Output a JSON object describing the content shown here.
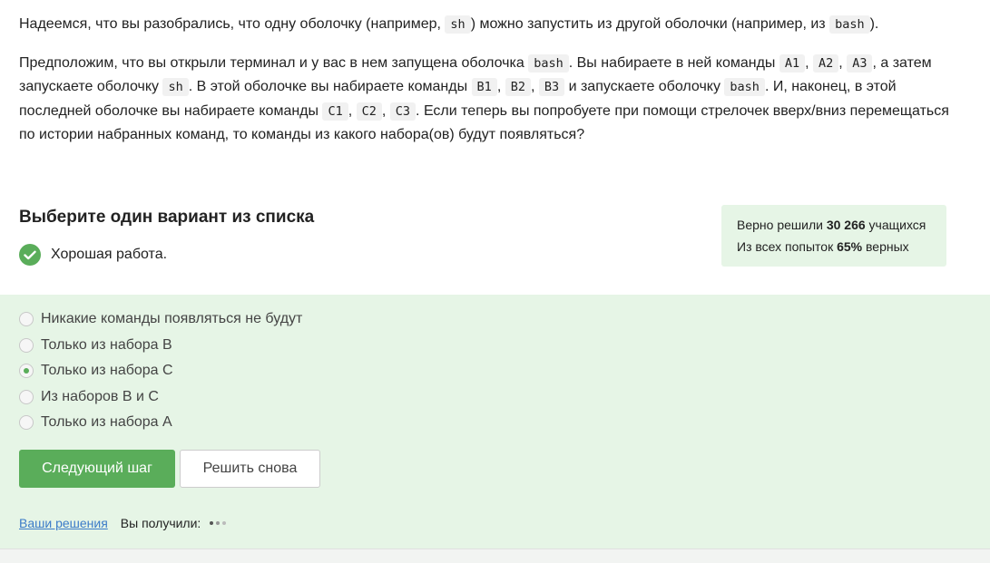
{
  "intro": {
    "p1": [
      {
        "t": "text",
        "v": "Надеемся, что вы разобрались, что одну оболочку (например, "
      },
      {
        "t": "code",
        "v": "sh"
      },
      {
        "t": "text",
        "v": ") можно запустить из другой оболочки (например, из "
      },
      {
        "t": "code",
        "v": "bash"
      },
      {
        "t": "text",
        "v": ")."
      }
    ],
    "p2": [
      {
        "t": "text",
        "v": "Предположим, что вы открыли терминал и у вас в нем запущена оболочка "
      },
      {
        "t": "code",
        "v": "bash"
      },
      {
        "t": "text",
        "v": ". Вы набираете в ней команды "
      },
      {
        "t": "code",
        "v": "A1"
      },
      {
        "t": "text",
        "v": ", "
      },
      {
        "t": "code",
        "v": "A2"
      },
      {
        "t": "text",
        "v": ", "
      },
      {
        "t": "code",
        "v": "A3"
      },
      {
        "t": "text",
        "v": ", а затем запускаете оболочку "
      },
      {
        "t": "code",
        "v": "sh"
      },
      {
        "t": "text",
        "v": ". В этой оболочке вы набираете команды "
      },
      {
        "t": "code",
        "v": "B1"
      },
      {
        "t": "text",
        "v": ", "
      },
      {
        "t": "code",
        "v": "B2"
      },
      {
        "t": "text",
        "v": ", "
      },
      {
        "t": "code",
        "v": "B3"
      },
      {
        "t": "text",
        "v": " и запускаете оболочку "
      },
      {
        "t": "code",
        "v": "bash"
      },
      {
        "t": "text",
        "v": ". И, наконец, в этой последней оболочке вы набираете команды "
      },
      {
        "t": "code",
        "v": "C1"
      },
      {
        "t": "text",
        "v": ", "
      },
      {
        "t": "code",
        "v": "C2"
      },
      {
        "t": "text",
        "v": ", "
      },
      {
        "t": "code",
        "v": "C3"
      },
      {
        "t": "text",
        "v": ". Если теперь вы попробуете при помощи стрелочек вверх/вниз перемещаться по истории набранных команд, то команды из какого набора(ов) будут появляться?"
      }
    ]
  },
  "quiz": {
    "heading": "Выберите один вариант из списка",
    "feedback": "Хорошая работа.",
    "stats": {
      "line1_prefix": "Верно решили ",
      "solved_count": "30 266",
      "line1_suffix": " учащихся",
      "line2_prefix": "Из всех попыток ",
      "percent": "65%",
      "line2_suffix": " верных"
    },
    "options": [
      {
        "label": "Никакие команды появляться не будут",
        "checked": false
      },
      {
        "label": "Только из набора B",
        "checked": false
      },
      {
        "label": "Только из набора C",
        "checked": true
      },
      {
        "label": "Из наборов B и C",
        "checked": false
      },
      {
        "label": "Только из набора A",
        "checked": false
      }
    ],
    "next_button": "Следующий шаг",
    "retry_button": "Решить снова",
    "solutions_link": "Ваши решения",
    "received_label": "Вы получили:"
  },
  "colors": {
    "accent": "#5aad5a",
    "answers_bg": "#e6f5e6",
    "link": "#3b7bc8"
  },
  "icons": {
    "feedback": "check-circle-icon",
    "score": "loading-dots-icon"
  }
}
